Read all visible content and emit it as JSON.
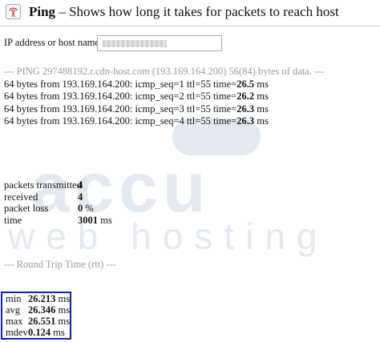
{
  "header": {
    "icon": "ping-signal-icon",
    "title": "Ping",
    "subtitle": "– Shows how long it takes for packets to reach host"
  },
  "form": {
    "label": "IP address or host name:",
    "value": ""
  },
  "console": {
    "header_line": "--- PING 297488192.r.cdn-host.com (193.169.164.200) 56(84) bytes of data. ---",
    "replies": [
      {
        "prefix": "64 bytes from 193.169.164.200: icmp_seq=1 ttl=55 time=",
        "time": "26.5",
        "unit": " ms"
      },
      {
        "prefix": "64 bytes from 193.169.164.200: icmp_seq=2 ttl=55 time=",
        "time": "26.2",
        "unit": " ms"
      },
      {
        "prefix": "64 bytes from 193.169.164.200: icmp_seq=3 ttl=55 time=",
        "time": "26.3",
        "unit": " ms"
      },
      {
        "prefix": "64 bytes from 193.169.164.200: icmp_seq=4 ttl=55 time=",
        "time": "26.3",
        "unit": " ms"
      }
    ]
  },
  "stats": [
    {
      "label": "packets transmitted",
      "value": "4",
      "unit": ""
    },
    {
      "label": "received",
      "value": "4",
      "unit": ""
    },
    {
      "label": "packet loss",
      "value": "0",
      "unit": " %"
    },
    {
      "label": "time",
      "value": "3001",
      "unit": " ms"
    }
  ],
  "rtt": {
    "heading": "--- Round Trip Time (rtt) ---",
    "rows": [
      {
        "label": "min",
        "value": "26.213",
        "unit": " ms"
      },
      {
        "label": "avg",
        "value": "26.346",
        "unit": " ms"
      },
      {
        "label": "max",
        "value": "26.551",
        "unit": " ms"
      },
      {
        "label": "mdev",
        "value": "0.124",
        "unit": " ms"
      }
    ],
    "highlight_color": "#1520a6"
  },
  "watermark": {
    "line1": "accu",
    "line2": "web hosting"
  }
}
